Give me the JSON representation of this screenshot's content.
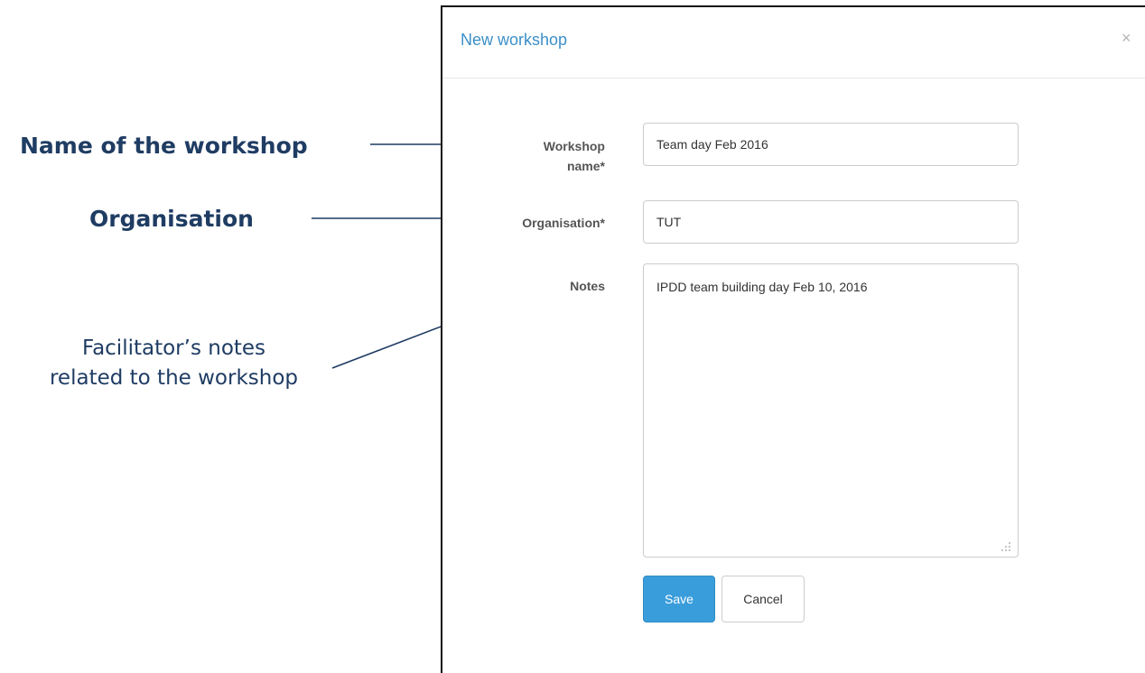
{
  "annotations": {
    "name": "Name of the workshop",
    "organisation": "Organisation",
    "notes_line1": "Facilitator’s notes",
    "notes_line2": "related to the workshop"
  },
  "modal": {
    "title": "New workshop",
    "close_icon": "×",
    "fields": {
      "name_label_line1": "Workshop",
      "name_label_line2": "name*",
      "name_value": "Team day Feb 2016",
      "org_label": "Organisation*",
      "org_value": "TUT",
      "notes_label": "Notes",
      "notes_value": "IPDD team building day Feb 10, 2016"
    },
    "buttons": {
      "save": "Save",
      "cancel": "Cancel"
    }
  },
  "colors": {
    "annotation": "#1f3c63",
    "title": "#3b8fc8",
    "primary_button": "#3a9ddb"
  }
}
